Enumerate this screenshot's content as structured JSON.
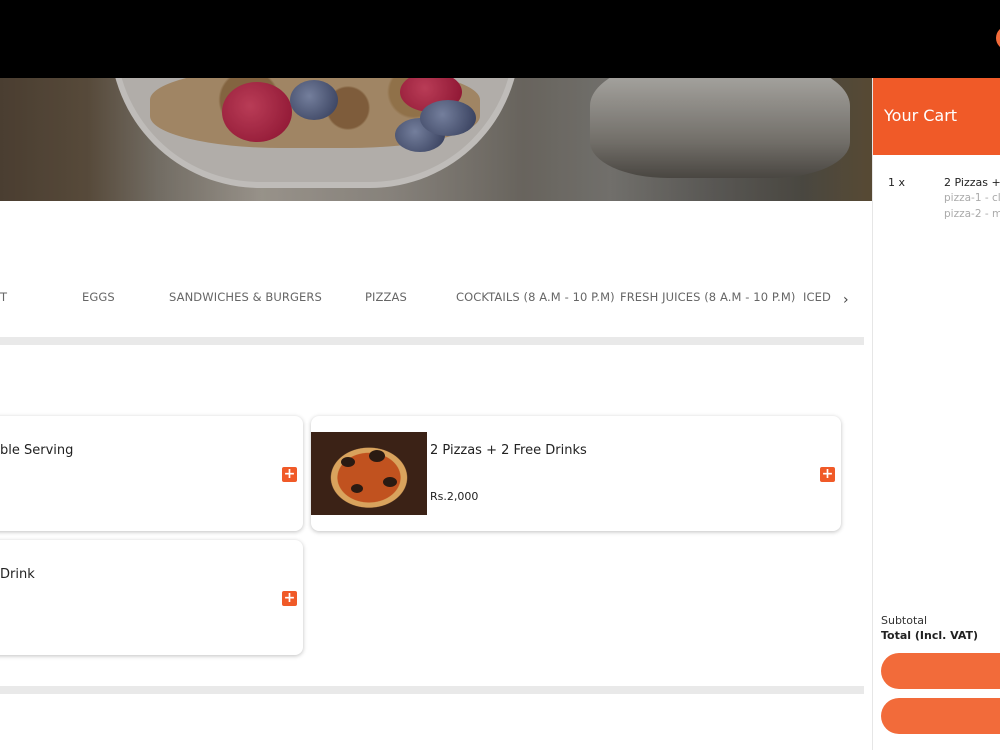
{
  "colors": {
    "accent": "#f05a28",
    "topbar": "#000000",
    "divider": "#e9e9e9"
  },
  "categories": [
    {
      "label": "T"
    },
    {
      "label": "EGGS"
    },
    {
      "label": "SANDWICHES & BURGERS"
    },
    {
      "label": "PIZZAS"
    },
    {
      "label": "COCKTAILS (8 A.M - 10 P.M)"
    },
    {
      "label": "FRESH JUICES (8 A.M - 10 P.M)"
    },
    {
      "label": "ICED"
    }
  ],
  "categories_next_icon": "chevron-right-icon",
  "menu_items": [
    {
      "title": "ble Serving",
      "price": "",
      "add_icon": "plus-icon"
    },
    {
      "title": "2 Pizzas + 2 Free Drinks",
      "price": "Rs.2,000",
      "image": "pizza",
      "add_icon": "plus-icon"
    },
    {
      "title": "Drink",
      "price": "",
      "add_icon": "plus-icon"
    }
  ],
  "cart": {
    "title": "Your Cart",
    "items": [
      {
        "qty": "1 x",
        "name": "2 Pizzas +",
        "options": [
          "pizza-1 - cl",
          "pizza-2 - m"
        ]
      }
    ],
    "subtotal_label": "Subtotal",
    "total_label": "Total (Incl. VAT)"
  }
}
